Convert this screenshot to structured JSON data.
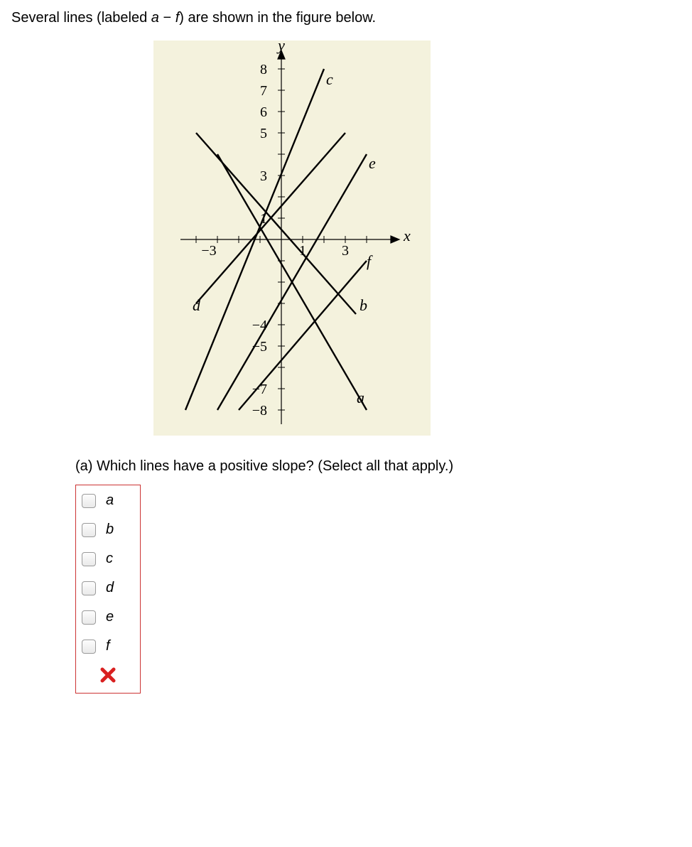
{
  "prompt_pre": "Several lines (labeled ",
  "prompt_a": "a",
  "prompt_dash": " − ",
  "prompt_f": "f",
  "prompt_post": ") are shown in the figure below.",
  "question": "(a) Which lines have a positive slope? (Select all that apply.)",
  "options": {
    "a": "a",
    "b": "b",
    "c": "c",
    "d": "d",
    "e": "e",
    "f": "f"
  },
  "chart_data": {
    "type": "line",
    "title": "",
    "xlabel": "x",
    "ylabel": "y",
    "xlim": [
      -5,
      5
    ],
    "ylim": [
      -9,
      9
    ],
    "x_ticks_shown": [
      -3,
      1,
      3
    ],
    "y_ticks_shown": [
      8,
      7,
      6,
      5,
      3,
      1,
      -4,
      -5,
      -7,
      -8
    ],
    "series": [
      {
        "name": "a",
        "slope": "negative",
        "points": [
          [
            -3,
            4
          ],
          [
            4,
            -8
          ]
        ]
      },
      {
        "name": "b",
        "slope": "negative",
        "points": [
          [
            -4,
            5
          ],
          [
            3.5,
            -3.5
          ]
        ]
      },
      {
        "name": "c",
        "slope": "positive",
        "points": [
          [
            -4.5,
            -8
          ],
          [
            2,
            8
          ]
        ]
      },
      {
        "name": "d",
        "slope": "positive",
        "points": [
          [
            -4,
            -3
          ],
          [
            3,
            5
          ]
        ]
      },
      {
        "name": "e",
        "slope": "positive",
        "points": [
          [
            -3,
            -8
          ],
          [
            4,
            4
          ]
        ]
      },
      {
        "name": "f",
        "slope": "positive",
        "points": [
          [
            -2,
            -8
          ],
          [
            4,
            -1
          ]
        ]
      }
    ],
    "line_labels": {
      "y": "y",
      "x": "x",
      "a": "a",
      "b": "b",
      "c": "c",
      "d": "d",
      "e": "e",
      "f": "f"
    }
  }
}
